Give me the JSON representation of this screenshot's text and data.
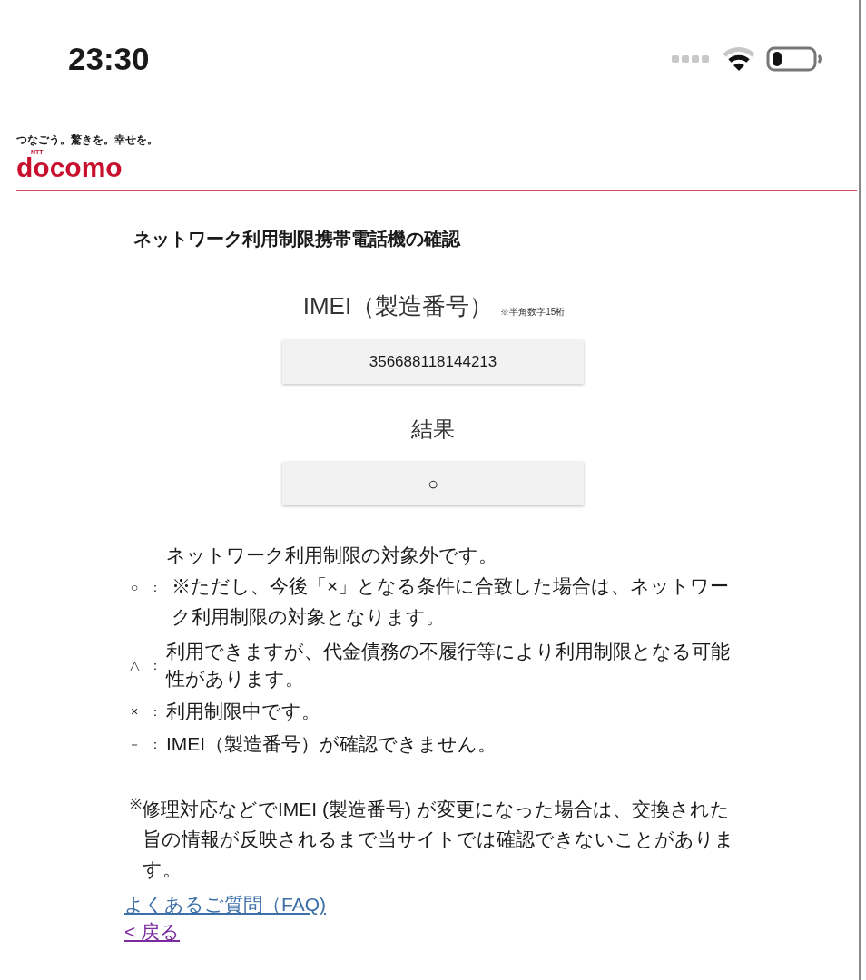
{
  "status_bar": {
    "time": "23:30"
  },
  "header": {
    "tagline": "つなごう。驚きを。幸せを。",
    "brand_small": "NTT",
    "brand": "docomo"
  },
  "title": "ネットワーク利用制限携帯電話機の確認",
  "imei": {
    "label": "IMEI（製造番号）",
    "hint": "※半角数字15桁",
    "value": "356688118144213"
  },
  "result": {
    "label": "結果",
    "value": "○"
  },
  "legend": [
    {
      "symbol": "○",
      "colon": "：",
      "text": "ネットワーク利用制限の対象外です。",
      "note": "※ただし、今後「×」となる条件に合致した場合は、ネットワーク利用制限の対象となります。"
    },
    {
      "symbol": "△",
      "colon": "：",
      "text": "利用できますが、代金債務の不履行等により利用制限となる可能性があります。"
    },
    {
      "symbol": "×",
      "colon": "：",
      "text": "利用制限中です。"
    },
    {
      "symbol": "－",
      "colon": "：",
      "text": "IMEI（製造番号）が確認できません。"
    }
  ],
  "footnote": "$^{※}$修理対応などでIMEI (製造番号) が変更になった場合は、交換された旨の情報が反映されるまで当サイトでは確認できないことがあります。",
  "links": [
    {
      "text": "よくあるご質問（FAQ)",
      "kind": "faq"
    },
    {
      "text": "< 戻る",
      "kind": "back"
    }
  ]
}
